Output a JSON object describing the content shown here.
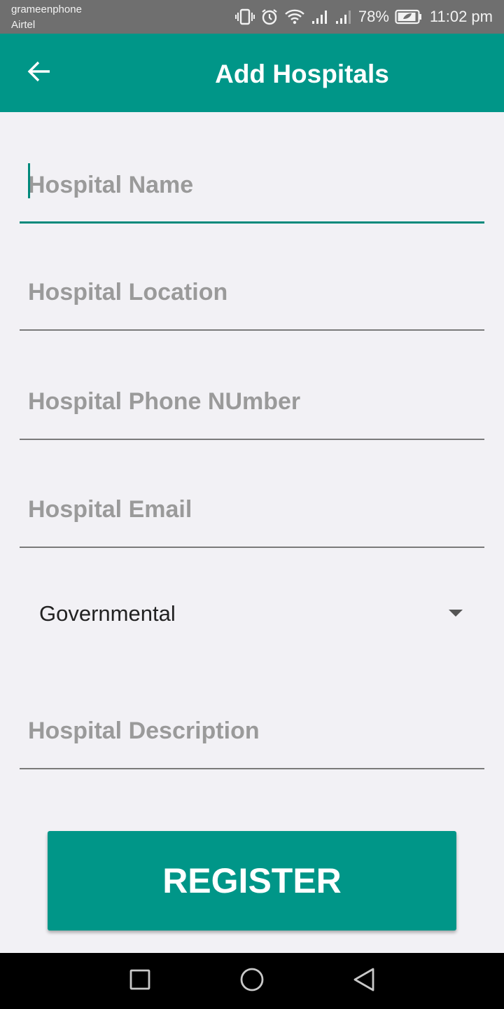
{
  "status_bar": {
    "carrier_1": "grameenphone",
    "carrier_2": "Airtel",
    "battery_percent": "78%",
    "time": "11:02 pm"
  },
  "app_bar": {
    "title": "Add Hospitals",
    "back_icon": "arrow-back-icon"
  },
  "form": {
    "hospital_name": {
      "placeholder": "Hospital Name",
      "value": ""
    },
    "hospital_location": {
      "placeholder": "Hospital Location",
      "value": ""
    },
    "hospital_phone": {
      "placeholder": "Hospital Phone NUmber",
      "value": ""
    },
    "hospital_email": {
      "placeholder": "Hospital Email",
      "value": ""
    },
    "hospital_type": {
      "selected": "Governmental"
    },
    "hospital_description": {
      "placeholder": "Hospital Description",
      "value": ""
    }
  },
  "register_label": "REGISTER",
  "nav": {
    "recents_icon": "square-recents-icon",
    "home_icon": "circle-home-icon",
    "back_icon": "triangle-back-icon"
  },
  "colors": {
    "primary": "#009688",
    "accent_underline": "#00897b",
    "background": "#f2f1f5",
    "status_bar": "#6f6f6f"
  }
}
